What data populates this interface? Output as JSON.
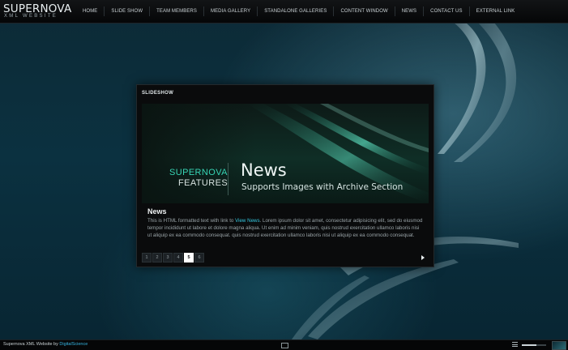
{
  "logo": {
    "title": "SUPERNOVA",
    "subtitle": "XML WEBSITE"
  },
  "nav": {
    "items": [
      {
        "label": "HOME"
      },
      {
        "label": "SLIDE SHOW"
      },
      {
        "label": "TEAM MEMBERS"
      },
      {
        "label": "MEDIA GALLERY"
      },
      {
        "label": "STANDALONE GALLERIES"
      },
      {
        "label": "CONTENT WINDOW"
      },
      {
        "label": "NEWS"
      },
      {
        "label": "CONTACT US"
      },
      {
        "label": "EXTERNAL LINK"
      }
    ]
  },
  "slideshow": {
    "title": "SLIDESHOW",
    "banner": {
      "brand_line1": "SUPERNOVA",
      "brand_line2": "FEATURES",
      "headline": "News",
      "subline": "Supports Images with Archive Section"
    },
    "news": {
      "title": "News",
      "body_before_link": "This is HTML formatted text with link to ",
      "link_text": "View News",
      "body_after_link": ". Lorem ipsum dolor sit amet, consectetur adipisicing elit, sed do eiusmod tempor incididunt ut labore et dolore magna aliqua. Ut enim ad minim veniam, quis nostrud exercitation ullamco laboris nisi ut aliquip ex ea commodo consequat. quis nostrud exercitation ullamco laboris nisi ut aliquip ex ea commodo consequat."
    },
    "pages": [
      "1",
      "2",
      "3",
      "4",
      "5",
      "6"
    ],
    "active_page": "5",
    "next_icon": "play-arrow-icon"
  },
  "footer": {
    "copyright_prefix": "Supernova XML Website by ",
    "copyright_link": "DigitalScience",
    "fullscreen_icon": "screen-icon",
    "menu_icon": "list-icon",
    "volume_level": 0.6,
    "thumbnail_icon": "background-thumbnail-icon"
  },
  "colors": {
    "accent": "#36c8e0",
    "brand_teal": "#37d4b4",
    "background": "#0b3140"
  }
}
